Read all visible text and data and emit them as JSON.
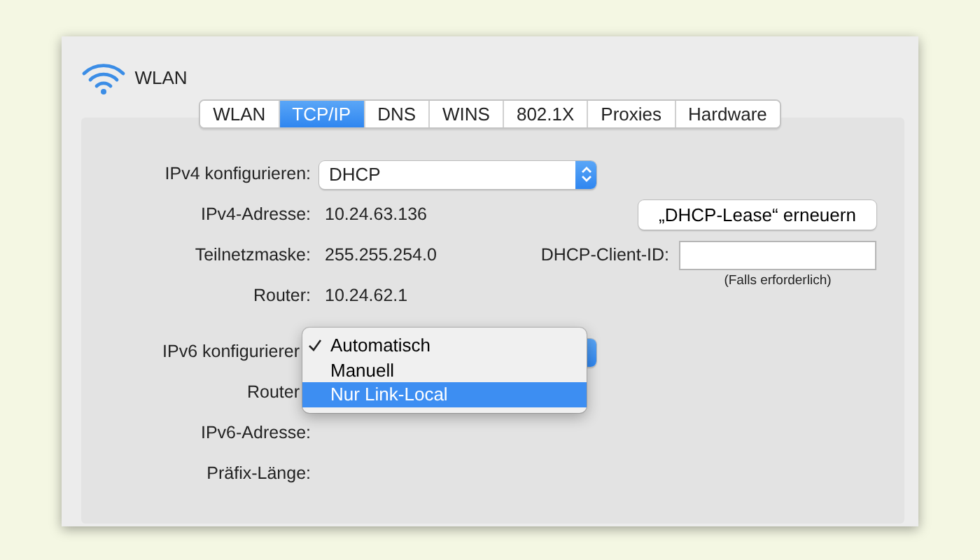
{
  "window": {
    "title": "WLAN"
  },
  "tabs": [
    {
      "label": "WLAN",
      "selected": false
    },
    {
      "label": "TCP/IP",
      "selected": true
    },
    {
      "label": "DNS",
      "selected": false
    },
    {
      "label": "WINS",
      "selected": false
    },
    {
      "label": "802.1X",
      "selected": false
    },
    {
      "label": "Proxies",
      "selected": false
    },
    {
      "label": "Hardware",
      "selected": false
    }
  ],
  "ipv4": {
    "label": "IPv4 konfigurieren:",
    "value": "DHCP"
  },
  "ipv4_fields": [
    {
      "label": "IPv4-Adresse:",
      "value": "10.24.63.136"
    },
    {
      "label": "Teilnetzmaske:",
      "value": "255.255.254.0"
    },
    {
      "label": "Router:",
      "value": "10.24.62.1"
    }
  ],
  "renew_button": "„DHCP-Lease“ erneuern",
  "client_id": {
    "label": "DHCP-Client-ID:",
    "hint": "(Falls erforderlich)"
  },
  "ipv6": {
    "label": "IPv6 konfigurierer",
    "menu": [
      {
        "label": "Automatisch",
        "checked": true,
        "selected": false
      },
      {
        "label": "Manuell",
        "checked": false,
        "selected": false
      },
      {
        "label": "Nur Link-Local",
        "checked": false,
        "selected": true
      }
    ]
  },
  "ipv6_fields": [
    {
      "label": "Router"
    },
    {
      "label": "IPv6-Adresse:"
    },
    {
      "label": "Präfix-Länge:"
    }
  ]
}
